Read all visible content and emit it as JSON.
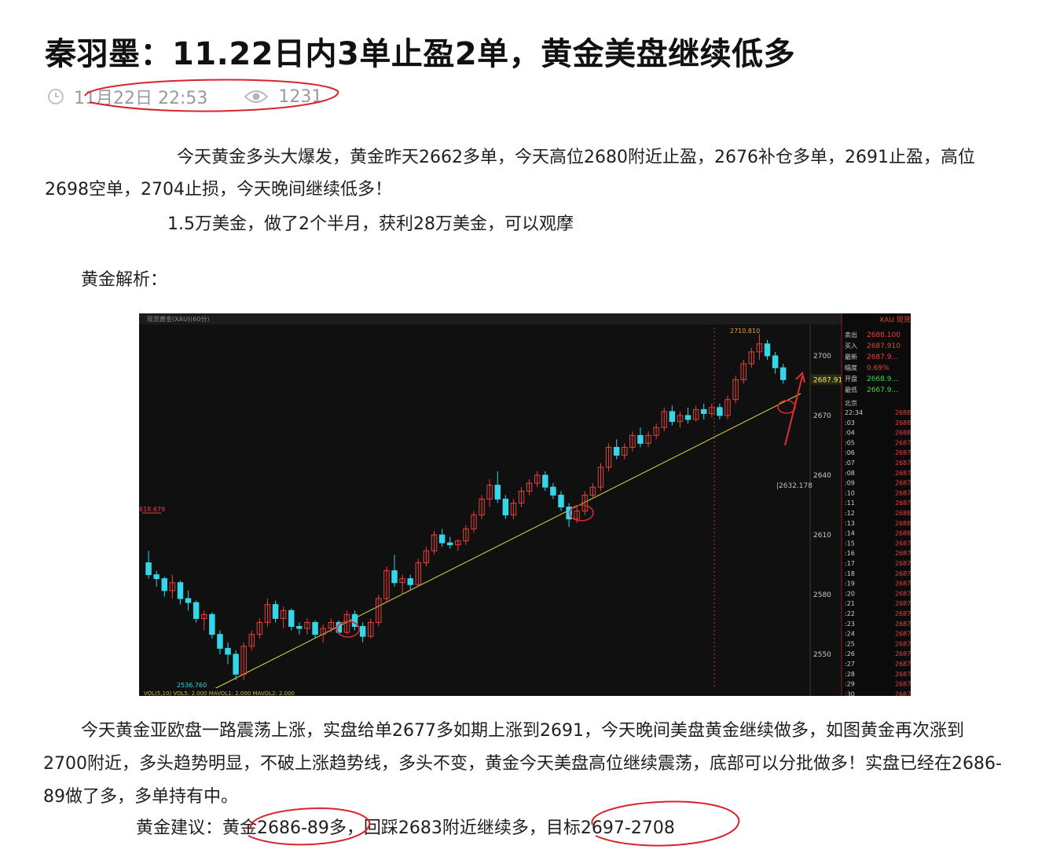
{
  "article": {
    "title": "秦羽墨：11.22日内3单止盈2单，黄金美盘继续低多",
    "date": "11月22日 22:53",
    "views": "1231",
    "icons": {
      "time": "clock-icon",
      "views": "eye-icon"
    },
    "paragraphs": {
      "intro": "今天黄金多头大爆发，黄金昨天2662多单，今天高位2680附近止盈，2676补仓多单，2691止盈，高位2698空单，2704止损，今天晚间继续低多！",
      "record": "1.5万美金，做了2个半月，获利28万美金，可以观摩",
      "analysis_heading": "黄金解析：",
      "analysis": "今天黄金亚欧盘一路震荡上涨，实盘给单2677多如期上涨到2691，今天晚间美盘黄金继续做多，如图黄金再次涨到2700附近，多头趋势明显，不破上涨趋势线，多头不变，黄金今天美盘高位继续震荡，底部可以分批做多！实盘已经在2686-89做了多，多单持有中。",
      "suggestion": "黄金建议：黄金2686-89多，回踩2683附近继续多，目标2697-2708"
    }
  },
  "chart_data": {
    "type": "candlestick",
    "title": "现货黄金(XAU)",
    "interval": "60分",
    "y_ticks": [
      2700,
      2670,
      2640,
      2610,
      2580,
      2550
    ],
    "ylim": [
      2532,
      2718
    ],
    "current_price": "2687.910",
    "reference_price": "2632.178",
    "left_level": "618.679",
    "high_label": "2710.810",
    "low_label": "2536.760",
    "indicator_text": "VOL(5,10) VOL5: 2.000  MAVOL1: 2.000  MAVOL2: 2.000",
    "up_color": "#e8413c",
    "down_color": "#35d6e8",
    "trendline_color": "#d8d84a",
    "candles": [
      {
        "o": 2596,
        "h": 2602,
        "l": 2588,
        "c": 2590
      },
      {
        "o": 2590,
        "h": 2592,
        "l": 2584,
        "c": 2588
      },
      {
        "o": 2588,
        "h": 2589,
        "l": 2579,
        "c": 2582
      },
      {
        "o": 2582,
        "h": 2590,
        "l": 2578,
        "c": 2586
      },
      {
        "o": 2586,
        "h": 2587,
        "l": 2575,
        "c": 2578
      },
      {
        "o": 2578,
        "h": 2582,
        "l": 2572,
        "c": 2576
      },
      {
        "o": 2576,
        "h": 2577,
        "l": 2566,
        "c": 2568
      },
      {
        "o": 2568,
        "h": 2572,
        "l": 2562,
        "c": 2570
      },
      {
        "o": 2570,
        "h": 2571,
        "l": 2558,
        "c": 2560
      },
      {
        "o": 2560,
        "h": 2562,
        "l": 2550,
        "c": 2553
      },
      {
        "o": 2553,
        "h": 2556,
        "l": 2545,
        "c": 2550
      },
      {
        "o": 2550,
        "h": 2552,
        "l": 2537,
        "c": 2540
      },
      {
        "o": 2540,
        "h": 2556,
        "l": 2537,
        "c": 2554
      },
      {
        "o": 2554,
        "h": 2562,
        "l": 2552,
        "c": 2560
      },
      {
        "o": 2560,
        "h": 2568,
        "l": 2558,
        "c": 2566
      },
      {
        "o": 2566,
        "h": 2578,
        "l": 2564,
        "c": 2575
      },
      {
        "o": 2575,
        "h": 2577,
        "l": 2566,
        "c": 2568
      },
      {
        "o": 2568,
        "h": 2574,
        "l": 2563,
        "c": 2572
      },
      {
        "o": 2572,
        "h": 2573,
        "l": 2562,
        "c": 2564
      },
      {
        "o": 2564,
        "h": 2566,
        "l": 2560,
        "c": 2563
      },
      {
        "o": 2563,
        "h": 2568,
        "l": 2560,
        "c": 2566
      },
      {
        "o": 2566,
        "h": 2567,
        "l": 2558,
        "c": 2560
      },
      {
        "o": 2560,
        "h": 2565,
        "l": 2556,
        "c": 2563
      },
      {
        "o": 2563,
        "h": 2568,
        "l": 2561,
        "c": 2566
      },
      {
        "o": 2566,
        "h": 2567,
        "l": 2560,
        "c": 2561
      },
      {
        "o": 2561,
        "h": 2572,
        "l": 2560,
        "c": 2570
      },
      {
        "o": 2570,
        "h": 2572,
        "l": 2562,
        "c": 2564
      },
      {
        "o": 2564,
        "h": 2566,
        "l": 2556,
        "c": 2559
      },
      {
        "o": 2559,
        "h": 2568,
        "l": 2558,
        "c": 2566
      },
      {
        "o": 2566,
        "h": 2580,
        "l": 2564,
        "c": 2578
      },
      {
        "o": 2578,
        "h": 2594,
        "l": 2576,
        "c": 2592
      },
      {
        "o": 2592,
        "h": 2600,
        "l": 2584,
        "c": 2586
      },
      {
        "o": 2586,
        "h": 2590,
        "l": 2580,
        "c": 2588
      },
      {
        "o": 2588,
        "h": 2590,
        "l": 2582,
        "c": 2585
      },
      {
        "o": 2585,
        "h": 2598,
        "l": 2584,
        "c": 2596
      },
      {
        "o": 2596,
        "h": 2604,
        "l": 2594,
        "c": 2602
      },
      {
        "o": 2602,
        "h": 2612,
        "l": 2600,
        "c": 2610
      },
      {
        "o": 2610,
        "h": 2613,
        "l": 2604,
        "c": 2606
      },
      {
        "o": 2606,
        "h": 2609,
        "l": 2603,
        "c": 2605
      },
      {
        "o": 2605,
        "h": 2608,
        "l": 2602,
        "c": 2607
      },
      {
        "o": 2607,
        "h": 2615,
        "l": 2605,
        "c": 2613
      },
      {
        "o": 2613,
        "h": 2622,
        "l": 2611,
        "c": 2620
      },
      {
        "o": 2620,
        "h": 2630,
        "l": 2618,
        "c": 2628
      },
      {
        "o": 2628,
        "h": 2638,
        "l": 2624,
        "c": 2635
      },
      {
        "o": 2635,
        "h": 2642,
        "l": 2626,
        "c": 2628
      },
      {
        "o": 2628,
        "h": 2630,
        "l": 2618,
        "c": 2620
      },
      {
        "o": 2620,
        "h": 2628,
        "l": 2618,
        "c": 2626
      },
      {
        "o": 2626,
        "h": 2634,
        "l": 2624,
        "c": 2632
      },
      {
        "o": 2632,
        "h": 2638,
        "l": 2630,
        "c": 2636
      },
      {
        "o": 2636,
        "h": 2642,
        "l": 2634,
        "c": 2640
      },
      {
        "o": 2640,
        "h": 2642,
        "l": 2632,
        "c": 2634
      },
      {
        "o": 2634,
        "h": 2636,
        "l": 2628,
        "c": 2630
      },
      {
        "o": 2630,
        "h": 2632,
        "l": 2622,
        "c": 2624
      },
      {
        "o": 2624,
        "h": 2626,
        "l": 2614,
        "c": 2618
      },
      {
        "o": 2618,
        "h": 2624,
        "l": 2616,
        "c": 2622
      },
      {
        "o": 2622,
        "h": 2632,
        "l": 2620,
        "c": 2630
      },
      {
        "o": 2630,
        "h": 2636,
        "l": 2628,
        "c": 2634
      },
      {
        "o": 2634,
        "h": 2646,
        "l": 2632,
        "c": 2644
      },
      {
        "o": 2644,
        "h": 2656,
        "l": 2642,
        "c": 2654
      },
      {
        "o": 2654,
        "h": 2658,
        "l": 2648,
        "c": 2650
      },
      {
        "o": 2650,
        "h": 2656,
        "l": 2648,
        "c": 2654
      },
      {
        "o": 2654,
        "h": 2662,
        "l": 2652,
        "c": 2660
      },
      {
        "o": 2660,
        "h": 2664,
        "l": 2654,
        "c": 2656
      },
      {
        "o": 2656,
        "h": 2662,
        "l": 2654,
        "c": 2660
      },
      {
        "o": 2660,
        "h": 2666,
        "l": 2658,
        "c": 2664
      },
      {
        "o": 2664,
        "h": 2674,
        "l": 2662,
        "c": 2672
      },
      {
        "o": 2672,
        "h": 2675,
        "l": 2665,
        "c": 2667
      },
      {
        "o": 2667,
        "h": 2672,
        "l": 2664,
        "c": 2670
      },
      {
        "o": 2670,
        "h": 2674,
        "l": 2666,
        "c": 2668
      },
      {
        "o": 2668,
        "h": 2675,
        "l": 2667,
        "c": 2673
      },
      {
        "o": 2673,
        "h": 2676,
        "l": 2668,
        "c": 2671
      },
      {
        "o": 2671,
        "h": 2676,
        "l": 2669,
        "c": 2674
      },
      {
        "o": 2674,
        "h": 2676,
        "l": 2668,
        "c": 2670
      },
      {
        "o": 2670,
        "h": 2680,
        "l": 2668,
        "c": 2678
      },
      {
        "o": 2678,
        "h": 2690,
        "l": 2676,
        "c": 2688
      },
      {
        "o": 2688,
        "h": 2698,
        "l": 2686,
        "c": 2696
      },
      {
        "o": 2696,
        "h": 2704,
        "l": 2694,
        "c": 2702
      },
      {
        "o": 2702,
        "h": 2711,
        "l": 2698,
        "c": 2706
      },
      {
        "o": 2706,
        "h": 2708,
        "l": 2698,
        "c": 2700
      },
      {
        "o": 2700,
        "h": 2702,
        "l": 2691,
        "c": 2694
      },
      {
        "o": 2694,
        "h": 2696,
        "l": 2686,
        "c": 2688
      }
    ]
  },
  "quote_panel": {
    "header": "XAU 现货",
    "rows": [
      {
        "label": "卖出",
        "value": "2688.100",
        "color": "#e8413c"
      },
      {
        "label": "买入",
        "value": "2687.910",
        "color": "#e8413c"
      },
      {
        "label": "最新",
        "value": "2687.9...",
        "color": "#e8413c"
      },
      {
        "label": "幅度",
        "value": "0.69%",
        "color": "#e8413c"
      },
      {
        "label": "开盘",
        "value": "2668.9...",
        "color": "#3bd34a"
      },
      {
        "label": "最低",
        "value": "2667.9...",
        "color": "#3bd34a"
      }
    ],
    "section_label": "北京",
    "ticks": {
      "times": [
        "22:34",
        ":03",
        ":04",
        ":05",
        ":06",
        ":07",
        ":08",
        ":09",
        ":10",
        ":11",
        ":12",
        ":13",
        ":14",
        ":15",
        ":16",
        ":17",
        ":18",
        ":19",
        ":20",
        ":21",
        ":22",
        ":23",
        ":24",
        ":25",
        ":26",
        ":27",
        ":28",
        ":29",
        ":30"
      ],
      "prices": [
        "2688",
        "2688",
        "2688",
        "2687",
        "2687",
        "2687",
        "2687",
        "2687",
        "2687",
        "2687",
        "2688",
        "2688",
        "2688",
        "2687",
        "2687",
        "2687",
        "2687",
        "2687",
        "2687",
        "2687",
        "2687",
        "2687",
        "2687",
        "2687",
        "2687",
        "2687",
        "2687",
        "2687",
        "2687"
      ]
    }
  },
  "colors": {
    "annotation_red": "#d9232e",
    "meta_gray": "#9a9a9a"
  }
}
